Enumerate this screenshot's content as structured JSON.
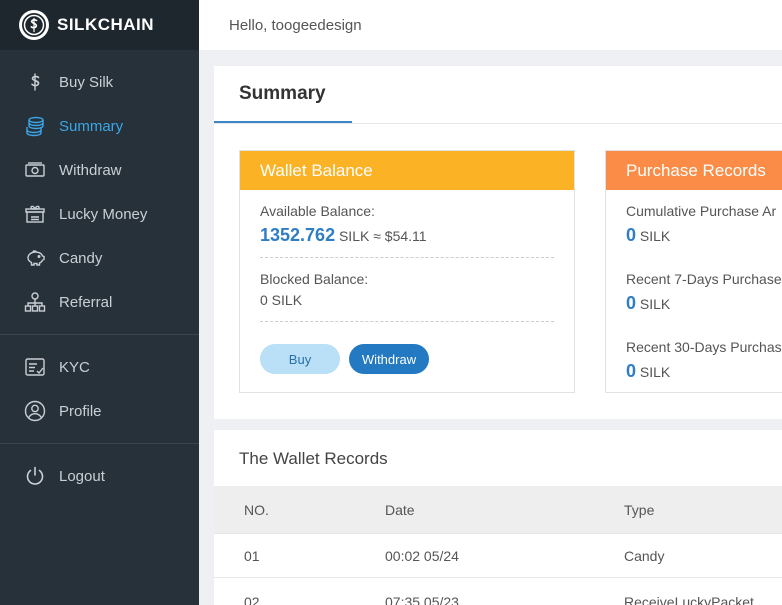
{
  "brand": {
    "name": "SILKCHAIN"
  },
  "header": {
    "greeting": "Hello, toogeedesign"
  },
  "sidebar": {
    "items": [
      {
        "label": "Buy Silk",
        "icon": "dollar-icon"
      },
      {
        "label": "Summary",
        "icon": "coins-stack-icon",
        "active": true
      },
      {
        "label": "Withdraw",
        "icon": "cash-icon"
      },
      {
        "label": "Lucky Money",
        "icon": "gift-box-icon"
      },
      {
        "label": "Candy",
        "icon": "piggy-bank-icon"
      },
      {
        "label": "Referral",
        "icon": "network-icon"
      },
      {
        "label": "KYC",
        "icon": "id-card-icon"
      },
      {
        "label": "Profile",
        "icon": "user-icon"
      },
      {
        "label": "Logout",
        "icon": "power-icon"
      }
    ]
  },
  "summary": {
    "tab": "Summary",
    "wallet": {
      "title": "Wallet Balance",
      "available_label": "Available Balance:",
      "available_value": "1352.762",
      "available_unit": "SILK ≈ $54.11",
      "blocked_label": "Blocked Balance:",
      "blocked_value": "0 SILK",
      "buy_label": "Buy",
      "withdraw_label": "Withdraw"
    },
    "purchase": {
      "title": "Purchase Records",
      "cumulative_label": "Cumulative Purchase Ar",
      "cumulative_value": "0",
      "recent7_label": "Recent 7-Days Purchase",
      "recent7_value": "0",
      "recent30_label": "Recent 30-Days Purchas",
      "recent30_value": "0",
      "unit": "SILK"
    }
  },
  "records": {
    "title": "The Wallet Records",
    "columns": [
      "NO.",
      "Date",
      "Type"
    ],
    "rows": [
      {
        "no": "01",
        "date": "00:02 05/24",
        "type": "Candy"
      },
      {
        "no": "02",
        "date": "07:35 05/23",
        "type": "ReceiveLuckyPacket"
      }
    ]
  },
  "colors": {
    "sidebar_bg": "#27313a",
    "active": "#3aa6e8",
    "wallet_head": "#fbb224",
    "purchase_head": "#fb8c47",
    "primary_button": "#2379c2"
  }
}
